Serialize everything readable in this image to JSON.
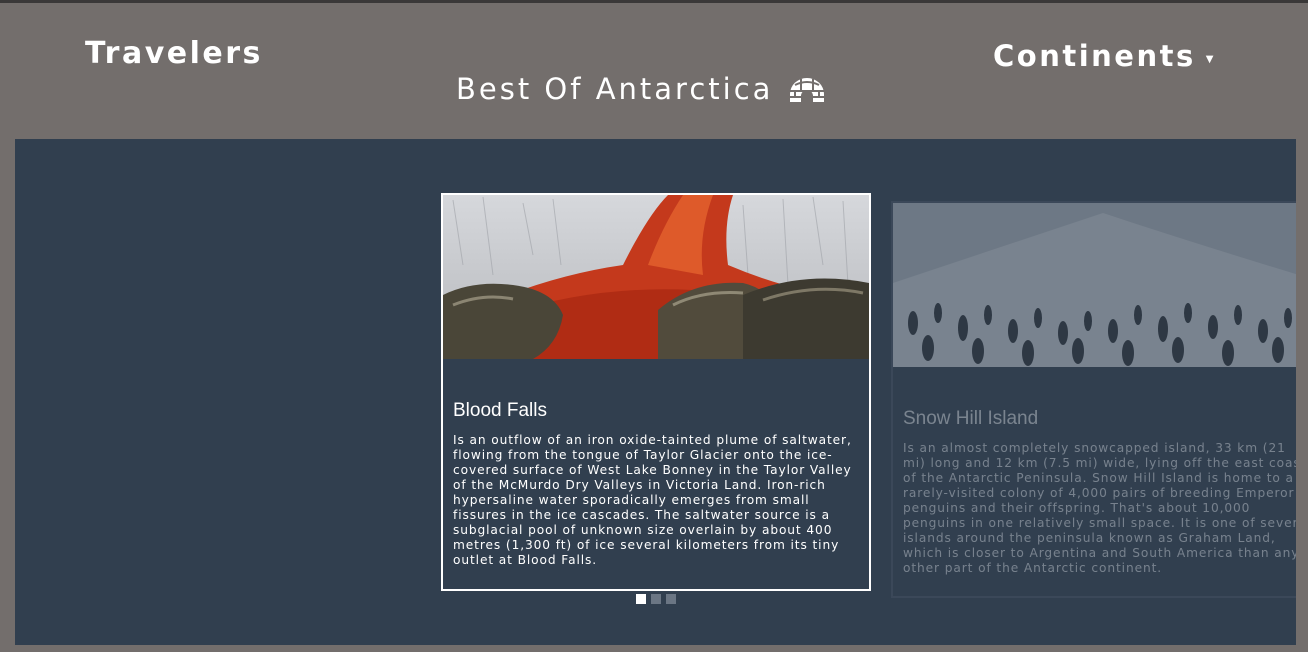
{
  "nav": {
    "brand": "Travelers",
    "continents_label": "Continents",
    "continents_caret": "▼"
  },
  "page": {
    "title": "Best Of Antarctica",
    "title_icon": "igloo-icon"
  },
  "carousel": {
    "active_index": 0,
    "slide_count": 3,
    "cards": [
      {
        "title": "Blood Falls",
        "text": "Is an outflow of an iron oxide-tainted plume of saltwater, flowing from the tongue of Taylor Glacier onto the ice-covered surface of West Lake Bonney in the Taylor Valley of the McMurdo Dry Valleys in Victoria Land. Iron-rich hypersaline water sporadically emerges from small fissures in the ice cascades. The saltwater source is a subglacial pool of unknown size overlain by about 400 metres (1,300 ft) of ice several kilometers from its tiny outlet at Blood Falls."
      },
      {
        "title": "Snow Hill Island",
        "text": "Is an almost completely snowcapped island, 33 km (21 mi) long and 12 km (7.5 mi) wide, lying off the east coast of the Antarctic Peninsula. Snow Hill Island is home to a rarely-visited colony of 4,000 pairs of breeding Emperor penguins and their offspring. That's about 10,000 penguins in one relatively small space. It is one of several islands around the peninsula known as Graham Land, which is closer to Argentina and South America than any other part of the Antarctic continent."
      }
    ]
  },
  "colors": {
    "header_bg": "#736e6c",
    "stage_bg": "#313f4f",
    "text": "#ffffff"
  }
}
